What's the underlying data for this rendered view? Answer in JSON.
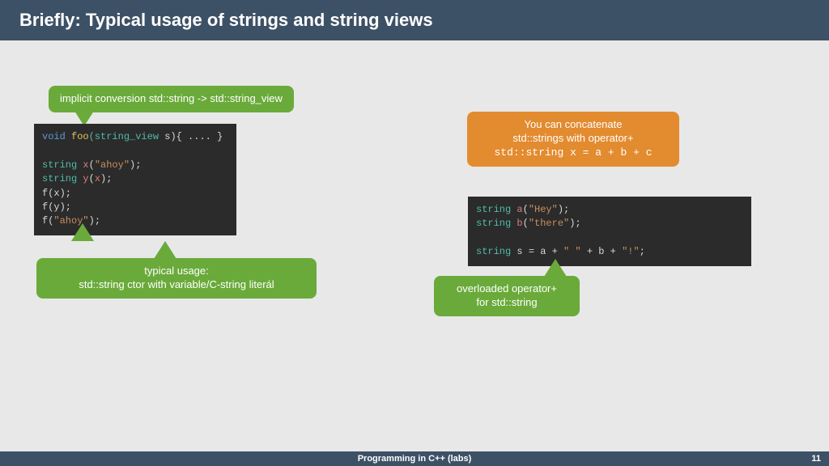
{
  "header": {
    "title": "Briefly: Typical usage of strings and string views"
  },
  "callouts": {
    "implicit": "implicit conversion std::string -> std::string_view",
    "typical_l1": "typical usage:",
    "typical_l2": "std::string ctor with variable/C-string literál",
    "concat_l1": "You can concatenate",
    "concat_l2": "std::strings with operator+",
    "concat_l3": "std::string x = a + b + c",
    "overload_l1": "overloaded operator+",
    "overload_l2": "for std::string"
  },
  "code1": {
    "l1_void": "void",
    "l1_foo": " foo",
    "l1_ty": "(string_view",
    "l1_rest": " s){ .... }",
    "l3_ty": "string",
    "l3_var": " x",
    "l3_open": "(",
    "l3_str": "\"ahoy\"",
    "l3_close": ");",
    "l4_ty": "string",
    "l4_var": " y",
    "l4_open": "(",
    "l4_arg": "x",
    "l4_close": ");",
    "l5": "f(x);",
    "l6": "f(y);",
    "l7_call": "f(",
    "l7_str": "\"ahoy\"",
    "l7_close": ");"
  },
  "code2": {
    "l1_ty": "string",
    "l1_var": " a",
    "l1_open": "(",
    "l1_str": "\"Hey\"",
    "l1_close": ");",
    "l2_ty": "string",
    "l2_var": " b",
    "l2_open": "(",
    "l2_str": "\"there\"",
    "l2_close": ");",
    "l4_ty": "string",
    "l4_rest1": " s = a + ",
    "l4_sp": "\" \"",
    "l4_rest2": " + b + ",
    "l4_ex": "\"!\"",
    "l4_end": ";"
  },
  "footer": {
    "course": "Programming in C++ (labs)",
    "page": "11"
  }
}
